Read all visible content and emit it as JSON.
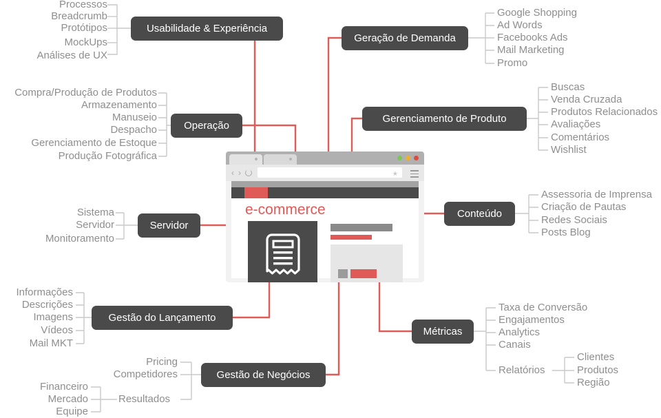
{
  "diagram": {
    "title": "e-commerce",
    "accent_color": "#e05a57",
    "node_color": "#4a4a4a",
    "leaf_color": "#8e8e8e",
    "center": {
      "label": "e-commerce",
      "type": "browser-mockup"
    },
    "nodes": [
      {
        "id": "usabilidade",
        "label": "Usabilidade & Experiência",
        "leaves": [
          "Processos",
          "Breadcrumb",
          "Protótipos",
          "MockUps",
          "Análises de UX"
        ]
      },
      {
        "id": "geracao-demanda",
        "label": "Geração de Demanda",
        "leaves": [
          "Google  Shopping",
          "Ad Words",
          "Facebooks Ads",
          "Mail Marketing",
          "Promo"
        ]
      },
      {
        "id": "operacao",
        "label": "Operação",
        "leaves": [
          "Compra/Produção de Produtos",
          "Armazenamento",
          "Manuseio",
          "Despacho",
          "Gerenciamento de Estoque",
          "Produção Fotográfica"
        ]
      },
      {
        "id": "gerenciamento-produto",
        "label": "Gerenciamento de Produto",
        "leaves": [
          "Buscas",
          "Venda Cruzada",
          "Produtos Relacionados",
          "Avaliações",
          "Comentários",
          "Wishlist"
        ]
      },
      {
        "id": "servidor",
        "label": "Servidor",
        "leaves": [
          "Sistema",
          "Servidor",
          "Monitoramento"
        ]
      },
      {
        "id": "conteudo",
        "label": "Conteúdo",
        "leaves": [
          "Assessoria de Imprensa",
          "Criação de Pautas",
          "Redes Sociais",
          "Posts Blog"
        ]
      },
      {
        "id": "gestao-lancamento",
        "label": "Gestão do Lançamento",
        "leaves": [
          "Informações",
          "Descrições",
          "Imagens",
          "Vídeos",
          "Mail MKT"
        ]
      },
      {
        "id": "gestao-negocios",
        "label": "Gestão de Negócios",
        "leaves": [
          "Pricing",
          "Competidores",
          "Resultados"
        ],
        "sub_leaves": [
          "Financeiro",
          "Mercado",
          "Equipe"
        ],
        "sub_parent": "Resultados"
      },
      {
        "id": "metricas",
        "label": "Métricas",
        "leaves": [
          "Taxa de Conversão",
          "Engajamentos",
          "Analytics",
          "Canais",
          "Relatórios"
        ],
        "sub_leaves": [
          "Clientes",
          "Produtos",
          "Região"
        ],
        "sub_parent": "Relatórios"
      }
    ]
  },
  "browser": {
    "traffic_lights": [
      "#7dc855",
      "#f0b12a",
      "#e04a3f"
    ],
    "tab_count": 2
  }
}
